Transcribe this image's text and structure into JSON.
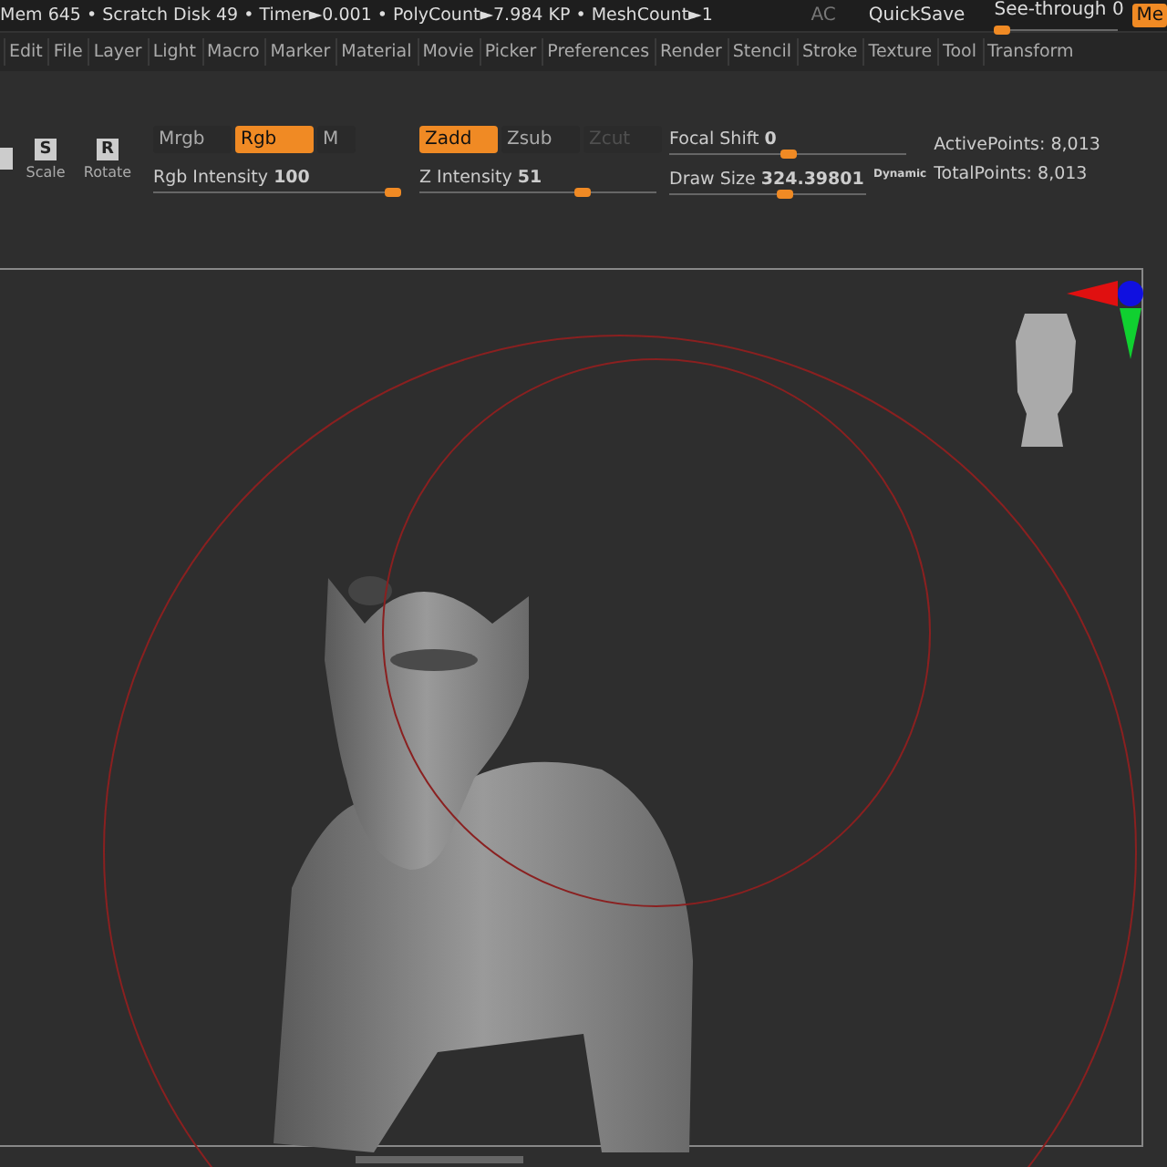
{
  "status_bar": {
    "stats": "Mem 645 • Scratch Disk 49 •  Timer►0.001 • PolyCount►7.984 KP  • MeshCount►1",
    "ac": "AC",
    "quicksave": "QuickSave",
    "see_through": {
      "label": "See-through",
      "value": "0",
      "level": 0
    },
    "menu_button": "Me"
  },
  "menu": [
    "Edit",
    "File",
    "Layer",
    "Light",
    "Macro",
    "Marker",
    "Material",
    "Movie",
    "Picker",
    "Preferences",
    "Render",
    "Stencil",
    "Stroke",
    "Texture",
    "Tool",
    "Transform"
  ],
  "tools": [
    {
      "letter": "S",
      "label": "Scale"
    },
    {
      "letter": "R",
      "label": "Rotate"
    }
  ],
  "rgb_modes": [
    {
      "label": "Mrgb",
      "selected": false
    },
    {
      "label": "Rgb",
      "selected": true
    },
    {
      "label": "M",
      "selected": false
    }
  ],
  "z_modes": [
    {
      "label": "Zadd",
      "selected": true,
      "disabled": false
    },
    {
      "label": "Zsub",
      "selected": false,
      "disabled": false
    },
    {
      "label": "Zcut",
      "selected": false,
      "disabled": true
    }
  ],
  "sliders": [
    {
      "label": "Rgb Intensity",
      "value": "100",
      "level": 1
    },
    {
      "label": "Z Intensity",
      "value": "51",
      "level": 0.7
    },
    {
      "label": "Focal Shift",
      "value": "0",
      "level": 0.5
    },
    {
      "label": "Draw Size",
      "value": "324.39801",
      "level": 0.6
    }
  ],
  "dynamic": "Dynamic",
  "points": [
    "ActivePoints: 8,013",
    "TotalPoints: 8,013"
  ]
}
